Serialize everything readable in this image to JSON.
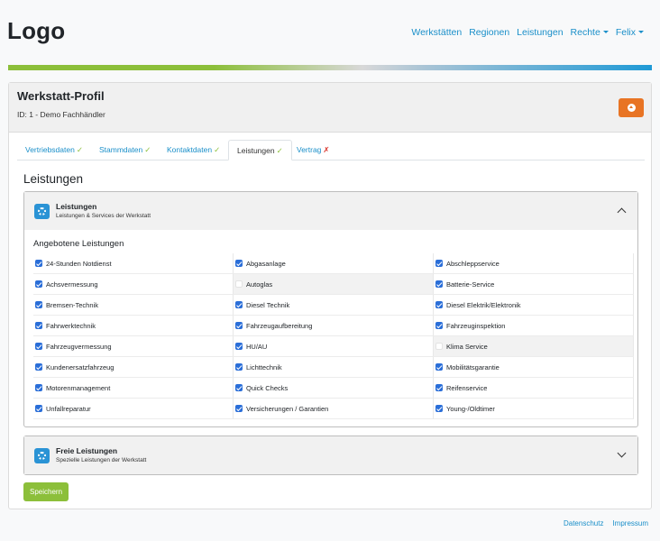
{
  "header": {
    "logo": "Logo",
    "nav": [
      {
        "label": "Werkstätten",
        "dropdown": false
      },
      {
        "label": "Regionen",
        "dropdown": false
      },
      {
        "label": "Leistungen",
        "dropdown": false
      },
      {
        "label": "Rechte",
        "dropdown": true
      },
      {
        "label": "Felix",
        "dropdown": true
      }
    ]
  },
  "profile": {
    "title": "Werkstatt-Profil",
    "subtitle": "ID: 1 - Demo Fachhändler"
  },
  "tabs": [
    {
      "label": "Vertriebsdaten",
      "status": "✓"
    },
    {
      "label": "Stammdaten",
      "status": "✓"
    },
    {
      "label": "Kontaktdaten",
      "status": "✓"
    },
    {
      "label": "Leistungen",
      "status": "✓"
    },
    {
      "label": "Vertrag",
      "status": "✗"
    }
  ],
  "section_title": "Leistungen",
  "accordion_services": {
    "title": "Leistungen",
    "description": "Leistungen & Services der Werkstatt",
    "sub_title": "Angebotene Leistungen",
    "items": [
      {
        "label": "24-Stunden Notdienst",
        "checked": true
      },
      {
        "label": "Abgasanlage",
        "checked": true
      },
      {
        "label": "Abschleppservice",
        "checked": true
      },
      {
        "label": "Achsvermessung",
        "checked": true
      },
      {
        "label": "Autoglas",
        "checked": false
      },
      {
        "label": "Batterie-Service",
        "checked": true
      },
      {
        "label": "Bremsen-Technik",
        "checked": true
      },
      {
        "label": "Diesel Technik",
        "checked": true
      },
      {
        "label": "Diesel Elektrik/Elektronik",
        "checked": true
      },
      {
        "label": "Fahrwerktechnik",
        "checked": true
      },
      {
        "label": "Fahrzeugaufbereitung",
        "checked": true
      },
      {
        "label": "Fahrzeuginspektion",
        "checked": true
      },
      {
        "label": "Fahrzeugvermessung",
        "checked": true
      },
      {
        "label": "HU/AU",
        "checked": true
      },
      {
        "label": "Klima Service",
        "checked": false
      },
      {
        "label": "Kundenersatzfahrzeug",
        "checked": true
      },
      {
        "label": "Lichttechnik",
        "checked": true
      },
      {
        "label": "Mobilitätsgarantie",
        "checked": true
      },
      {
        "label": "Motorenmanagement",
        "checked": true
      },
      {
        "label": "Quick Checks",
        "checked": true
      },
      {
        "label": "Reifenservice",
        "checked": true
      },
      {
        "label": "Unfallreparatur",
        "checked": true
      },
      {
        "label": "Versicherungen / Garantien",
        "checked": true
      },
      {
        "label": "Young-/Oldtimer",
        "checked": true
      }
    ]
  },
  "accordion_free": {
    "title": "Freie Leistungen",
    "description": "Spezielle Leistungen der Werkstatt"
  },
  "save_label": "Speichern",
  "footer": {
    "privacy": "Datenschutz",
    "imprint": "Impressum"
  },
  "colors": {
    "accent": "#1a8fc9",
    "upload_button": "#e87424",
    "save_button": "#8cbf3a",
    "ok": "#8cbf3a",
    "error": "#d9342b"
  }
}
